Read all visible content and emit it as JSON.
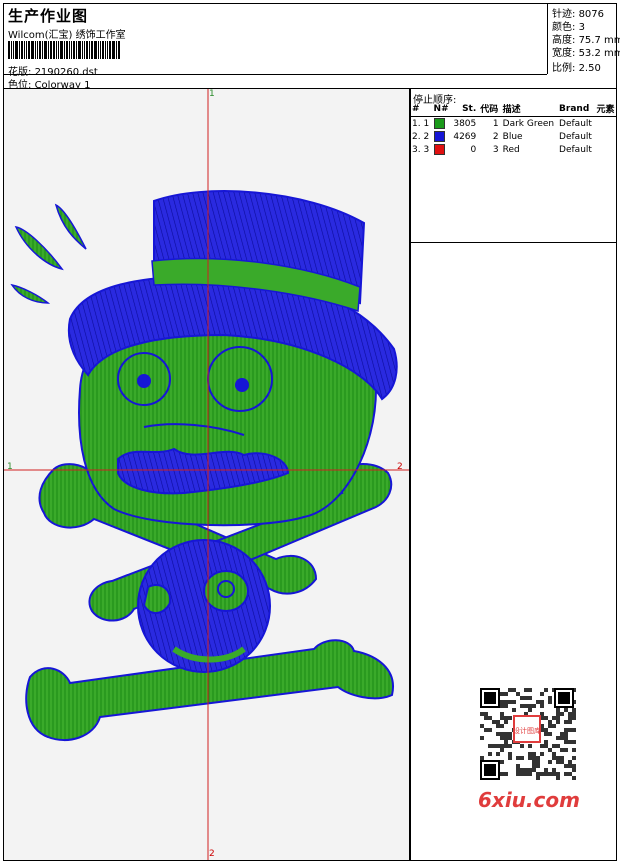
{
  "header": {
    "title": "生产作业图",
    "company": "Wilcom(汇宝) 绣饰工作室",
    "design_label": "花版:",
    "design_value": "2190260.dst",
    "colorway_label": "色位:",
    "colorway_value": "Colorway 1"
  },
  "stats": {
    "stitches_label": "针迹:",
    "stitches_value": "8076",
    "colors_label": "颜色:",
    "colors_value": "3",
    "height_label": "高度:",
    "height_value": "75.7 mm",
    "width_label": "宽度:",
    "width_value": "53.2 mm",
    "scale_label": "比例:",
    "scale_value": "2.50"
  },
  "stop_panel": {
    "title": "停止顺序:",
    "columns": [
      "#",
      "N#",
      "St.",
      "代码",
      "描述",
      "Brand",
      "元素"
    ],
    "rows": [
      {
        "index": "1. 1",
        "stitches": "3805",
        "code": "1",
        "description": "Dark Green",
        "brand": "Default",
        "color": "#1a9a1a"
      },
      {
        "index": "2. 2",
        "stitches": "4269",
        "code": "2",
        "description": "Blue",
        "brand": "Default",
        "color": "#1616d6"
      },
      {
        "index": "3. 3",
        "stitches": "0",
        "code": "3",
        "description": "Red",
        "brand": "Default",
        "color": "#e01010"
      }
    ]
  },
  "axes": {
    "top": "1",
    "bottom": "2",
    "left": "1",
    "right": "2"
  },
  "watermark": {
    "site": "6xiu.com",
    "stamp": "设计图库"
  },
  "colors": {
    "green": "#1a9a1a",
    "blue": "#1616d6",
    "red": "#e01010",
    "background": "#f3f3f3"
  }
}
